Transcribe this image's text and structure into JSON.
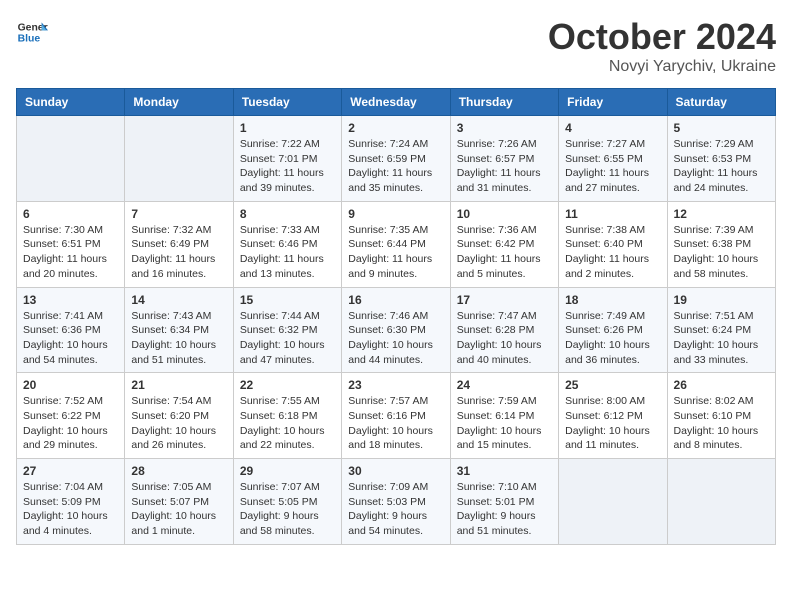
{
  "header": {
    "logo_line1": "General",
    "logo_line2": "Blue",
    "month": "October 2024",
    "location": "Novyi Yarychiv, Ukraine"
  },
  "weekdays": [
    "Sunday",
    "Monday",
    "Tuesday",
    "Wednesday",
    "Thursday",
    "Friday",
    "Saturday"
  ],
  "weeks": [
    [
      {
        "day": "",
        "info": ""
      },
      {
        "day": "",
        "info": ""
      },
      {
        "day": "1",
        "info": "Sunrise: 7:22 AM\nSunset: 7:01 PM\nDaylight: 11 hours\nand 39 minutes."
      },
      {
        "day": "2",
        "info": "Sunrise: 7:24 AM\nSunset: 6:59 PM\nDaylight: 11 hours\nand 35 minutes."
      },
      {
        "day": "3",
        "info": "Sunrise: 7:26 AM\nSunset: 6:57 PM\nDaylight: 11 hours\nand 31 minutes."
      },
      {
        "day": "4",
        "info": "Sunrise: 7:27 AM\nSunset: 6:55 PM\nDaylight: 11 hours\nand 27 minutes."
      },
      {
        "day": "5",
        "info": "Sunrise: 7:29 AM\nSunset: 6:53 PM\nDaylight: 11 hours\nand 24 minutes."
      }
    ],
    [
      {
        "day": "6",
        "info": "Sunrise: 7:30 AM\nSunset: 6:51 PM\nDaylight: 11 hours\nand 20 minutes."
      },
      {
        "day": "7",
        "info": "Sunrise: 7:32 AM\nSunset: 6:49 PM\nDaylight: 11 hours\nand 16 minutes."
      },
      {
        "day": "8",
        "info": "Sunrise: 7:33 AM\nSunset: 6:46 PM\nDaylight: 11 hours\nand 13 minutes."
      },
      {
        "day": "9",
        "info": "Sunrise: 7:35 AM\nSunset: 6:44 PM\nDaylight: 11 hours\nand 9 minutes."
      },
      {
        "day": "10",
        "info": "Sunrise: 7:36 AM\nSunset: 6:42 PM\nDaylight: 11 hours\nand 5 minutes."
      },
      {
        "day": "11",
        "info": "Sunrise: 7:38 AM\nSunset: 6:40 PM\nDaylight: 11 hours\nand 2 minutes."
      },
      {
        "day": "12",
        "info": "Sunrise: 7:39 AM\nSunset: 6:38 PM\nDaylight: 10 hours\nand 58 minutes."
      }
    ],
    [
      {
        "day": "13",
        "info": "Sunrise: 7:41 AM\nSunset: 6:36 PM\nDaylight: 10 hours\nand 54 minutes."
      },
      {
        "day": "14",
        "info": "Sunrise: 7:43 AM\nSunset: 6:34 PM\nDaylight: 10 hours\nand 51 minutes."
      },
      {
        "day": "15",
        "info": "Sunrise: 7:44 AM\nSunset: 6:32 PM\nDaylight: 10 hours\nand 47 minutes."
      },
      {
        "day": "16",
        "info": "Sunrise: 7:46 AM\nSunset: 6:30 PM\nDaylight: 10 hours\nand 44 minutes."
      },
      {
        "day": "17",
        "info": "Sunrise: 7:47 AM\nSunset: 6:28 PM\nDaylight: 10 hours\nand 40 minutes."
      },
      {
        "day": "18",
        "info": "Sunrise: 7:49 AM\nSunset: 6:26 PM\nDaylight: 10 hours\nand 36 minutes."
      },
      {
        "day": "19",
        "info": "Sunrise: 7:51 AM\nSunset: 6:24 PM\nDaylight: 10 hours\nand 33 minutes."
      }
    ],
    [
      {
        "day": "20",
        "info": "Sunrise: 7:52 AM\nSunset: 6:22 PM\nDaylight: 10 hours\nand 29 minutes."
      },
      {
        "day": "21",
        "info": "Sunrise: 7:54 AM\nSunset: 6:20 PM\nDaylight: 10 hours\nand 26 minutes."
      },
      {
        "day": "22",
        "info": "Sunrise: 7:55 AM\nSunset: 6:18 PM\nDaylight: 10 hours\nand 22 minutes."
      },
      {
        "day": "23",
        "info": "Sunrise: 7:57 AM\nSunset: 6:16 PM\nDaylight: 10 hours\nand 18 minutes."
      },
      {
        "day": "24",
        "info": "Sunrise: 7:59 AM\nSunset: 6:14 PM\nDaylight: 10 hours\nand 15 minutes."
      },
      {
        "day": "25",
        "info": "Sunrise: 8:00 AM\nSunset: 6:12 PM\nDaylight: 10 hours\nand 11 minutes."
      },
      {
        "day": "26",
        "info": "Sunrise: 8:02 AM\nSunset: 6:10 PM\nDaylight: 10 hours\nand 8 minutes."
      }
    ],
    [
      {
        "day": "27",
        "info": "Sunrise: 7:04 AM\nSunset: 5:09 PM\nDaylight: 10 hours\nand 4 minutes."
      },
      {
        "day": "28",
        "info": "Sunrise: 7:05 AM\nSunset: 5:07 PM\nDaylight: 10 hours\nand 1 minute."
      },
      {
        "day": "29",
        "info": "Sunrise: 7:07 AM\nSunset: 5:05 PM\nDaylight: 9 hours\nand 58 minutes."
      },
      {
        "day": "30",
        "info": "Sunrise: 7:09 AM\nSunset: 5:03 PM\nDaylight: 9 hours\nand 54 minutes."
      },
      {
        "day": "31",
        "info": "Sunrise: 7:10 AM\nSunset: 5:01 PM\nDaylight: 9 hours\nand 51 minutes."
      },
      {
        "day": "",
        "info": ""
      },
      {
        "day": "",
        "info": ""
      }
    ]
  ]
}
